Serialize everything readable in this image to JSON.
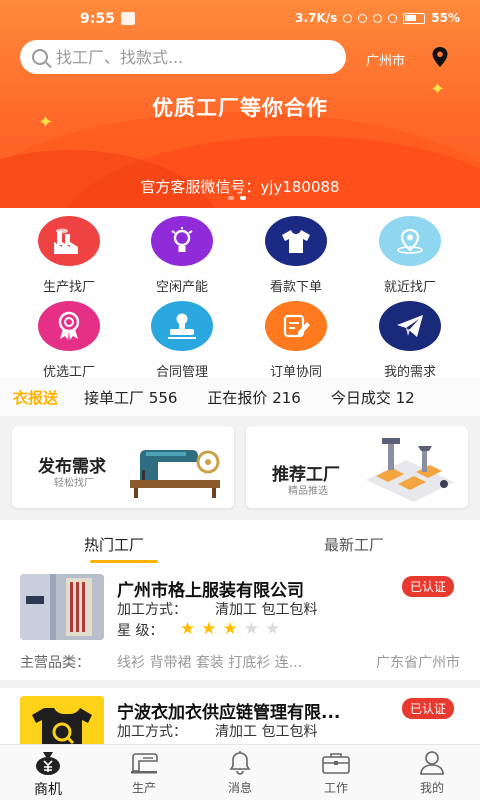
{
  "status_bar": {
    "time": "9:55",
    "network_speed": "3.7K/s",
    "battery": "55%"
  },
  "header": {
    "search_placeholder": "找工厂、找款式...",
    "city": "广州市",
    "slogan": "优质工厂等你合作",
    "service_wechat": "官方客服微信号：yjy180088"
  },
  "grid": [
    {
      "label": "生产找厂",
      "icon": "factory-icon",
      "color": "#ef4343"
    },
    {
      "label": "空闲产能",
      "icon": "lightbulb-icon",
      "color": "#8f2bd8"
    },
    {
      "label": "看款下单",
      "icon": "tshirt-icon",
      "color": "#1b2b85"
    },
    {
      "label": "就近找厂",
      "icon": "location-icon",
      "color": "#8fd7f0"
    },
    {
      "label": "优选工厂",
      "icon": "award-icon",
      "color": "#e62f86"
    },
    {
      "label": "合同管理",
      "icon": "stamp-icon",
      "color": "#29a7de"
    },
    {
      "label": "订单协同",
      "icon": "edit-icon",
      "color": "#ff7a1f"
    },
    {
      "label": "我的需求",
      "icon": "paper-plane-icon",
      "color": "#1a2a7a"
    }
  ],
  "ticker": {
    "tag": "衣报送",
    "items": [
      "接单工厂 556",
      "正在报价 216",
      "今日成交 12"
    ]
  },
  "promo": [
    {
      "title": "发布需求",
      "subtitle": "轻松找厂",
      "image": "sewing-machine-illustration"
    },
    {
      "title": "推荐工厂",
      "subtitle": "精品推选",
      "image": "factory-line-illustration"
    }
  ],
  "tabs": [
    "热门工厂",
    "最新工厂"
  ],
  "factories": [
    {
      "name": "广州市格上服装有限公司",
      "badge": "已认证",
      "process_label": "加工方式：",
      "process": "清加工 包工包料",
      "rating_label": "星  级：",
      "rating": 3,
      "rating_max": 5,
      "main_label": "主营品类：",
      "main": "线衫 背带裙 套装 打底衫 连...",
      "region": "广东省广州市"
    },
    {
      "name": "宁波衣加衣供应链管理有限...",
      "badge": "已认证",
      "process_label": "加工方式：",
      "process": "清加工 包工包料"
    }
  ],
  "nav": [
    {
      "label": "商机",
      "icon": "money-bag-icon",
      "active": true
    },
    {
      "label": "生产",
      "icon": "sewing-machine-icon",
      "active": false
    },
    {
      "label": "消息",
      "icon": "bell-icon",
      "active": false
    },
    {
      "label": "工作",
      "icon": "briefcase-icon",
      "active": false
    },
    {
      "label": "我的",
      "icon": "user-icon",
      "active": false
    }
  ]
}
